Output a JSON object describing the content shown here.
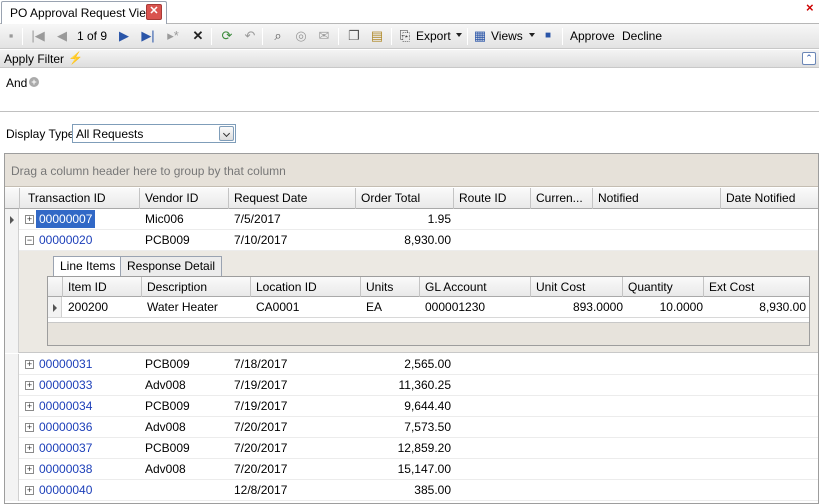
{
  "tab": {
    "title": "PO Approval Request View",
    "close_glyph": "✕"
  },
  "toolbar": {
    "pager": "1 of 9",
    "export_label": "Export",
    "views_label": "Views",
    "approve_label": "Approve",
    "decline_label": "Decline"
  },
  "filter": {
    "title": "Apply Filter",
    "and_label": "And"
  },
  "display_type": {
    "label": "Display Type",
    "value": "All Requests"
  },
  "grid": {
    "group_hint": "Drag a column header here to group by that column",
    "columns": [
      "Transaction ID",
      "Vendor ID",
      "Request Date",
      "Order Total",
      "Route ID",
      "Curren...",
      "Notified",
      "Date Notified"
    ],
    "rows": [
      {
        "transaction_id": "00000007",
        "vendor_id": "Mic006",
        "request_date": "7/5/2017",
        "order_total": "1.95",
        "expander": "+"
      },
      {
        "transaction_id": "00000020",
        "vendor_id": "PCB009",
        "request_date": "7/10/2017",
        "order_total": "8,930.00",
        "expander": "−"
      },
      {
        "transaction_id": "00000031",
        "vendor_id": "PCB009",
        "request_date": "7/18/2017",
        "order_total": "2,565.00",
        "expander": "+"
      },
      {
        "transaction_id": "00000033",
        "vendor_id": "Adv008",
        "request_date": "7/19/2017",
        "order_total": "11,360.25",
        "expander": "+"
      },
      {
        "transaction_id": "00000034",
        "vendor_id": "PCB009",
        "request_date": "7/19/2017",
        "order_total": "9,644.40",
        "expander": "+"
      },
      {
        "transaction_id": "00000036",
        "vendor_id": "Adv008",
        "request_date": "7/20/2017",
        "order_total": "7,573.50",
        "expander": "+"
      },
      {
        "transaction_id": "00000037",
        "vendor_id": "PCB009",
        "request_date": "7/20/2017",
        "order_total": "12,859.20",
        "expander": "+"
      },
      {
        "transaction_id": "00000038",
        "vendor_id": "Adv008",
        "request_date": "7/20/2017",
        "order_total": "15,147.00",
        "expander": "+"
      },
      {
        "transaction_id": "00000040",
        "vendor_id": "",
        "request_date": "12/8/2017",
        "order_total": "385.00",
        "expander": "+"
      }
    ]
  },
  "detail": {
    "tabs": [
      "Line Items",
      "Response Detail"
    ],
    "columns": [
      "Item ID",
      "Description",
      "Location ID",
      "Units",
      "GL Account",
      "Unit Cost",
      "Quantity",
      "Ext Cost"
    ],
    "row": {
      "item_id": "200200",
      "description": "Water Heater",
      "location_id": "CA0001",
      "units": "EA",
      "gl_account": "000001230",
      "unit_cost": "893.0000",
      "quantity": "10.0000",
      "ext_cost": "8,930.00"
    }
  }
}
